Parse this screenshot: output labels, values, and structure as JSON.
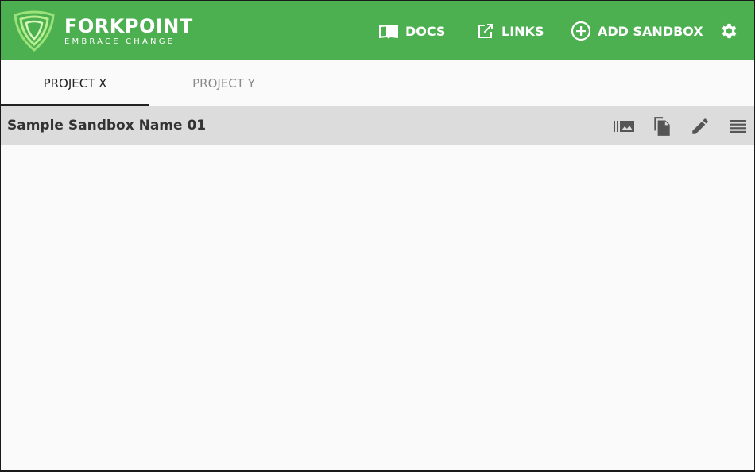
{
  "brand": {
    "name": "FORKPOINT",
    "tagline": "EMBRACE CHANGE",
    "color": "#4caf50",
    "logo_icon": "shield-logo-icon"
  },
  "nav": {
    "docs": {
      "label": "DOCS",
      "icon": "book-icon"
    },
    "links": {
      "label": "LINKS",
      "icon": "open-in-new-icon"
    },
    "add_sandbox": {
      "label": "ADD SANDBOX",
      "icon": "add-circle-icon"
    },
    "settings": {
      "icon": "gear-icon"
    }
  },
  "tabs": [
    {
      "label": "PROJECT X",
      "active": true
    },
    {
      "label": "PROJECT Y",
      "active": false
    }
  ],
  "sandbox": {
    "name": "Sample Sandbox Name 01",
    "actions": [
      "gallery-icon",
      "copy-icon",
      "edit-icon",
      "menu-icon"
    ]
  }
}
